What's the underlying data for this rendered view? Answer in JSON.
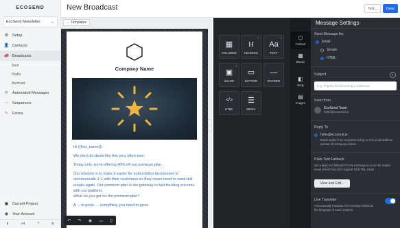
{
  "sidebar": {
    "logo": "ECOSEND",
    "account": "EcoSend Newsletter",
    "account_caret": "⌄",
    "items": [
      {
        "label": "Setup",
        "icon": "gear-icon",
        "glyph": "⚙"
      },
      {
        "label": "Contacts",
        "icon": "user-icon",
        "glyph": "👤"
      },
      {
        "label": "Broadcasts",
        "icon": "megaphone-icon",
        "glyph": "📣"
      }
    ],
    "broadcast_sub": [
      "Sent",
      "Drafts",
      "Archived"
    ],
    "items2": [
      {
        "label": "Automated Messages",
        "icon": "automation-icon",
        "glyph": "⟳"
      },
      {
        "label": "Sequences",
        "icon": "sequence-icon",
        "glyph": "⋯"
      },
      {
        "label": "Forms",
        "icon": "pencil-icon",
        "glyph": "✎"
      }
    ],
    "bottom": [
      {
        "label": "Current Project",
        "icon": "folder-icon",
        "glyph": "▣"
      },
      {
        "label": "Your Account",
        "icon": "account-icon",
        "glyph": "◉"
      }
    ],
    "bottom_bar": [
      "⬆",
      "v4",
      "?",
      "⚙"
    ]
  },
  "header": {
    "title": "New Broadcast",
    "test_label": "Test...",
    "done_label": "Done"
  },
  "canvas": {
    "templates_button": "← Templates",
    "company_name": "Company Name",
    "greeting": "Hi {{first_name}}!",
    "para1": "We don't do deals like this very often ever.",
    "para2": "Today only, we're offering 40% off our premium plan.",
    "para3": "Our mission is to make it easier for subscription businesses to communicate 1-1 with their customers so they never need to send dull emails again. Our premium plan is the gateway to fast tracking success with our platform.",
    "para4": "What do you get on the premium plan?",
    "para5": "A ... to grow.",
    "para6": "... everything you need to grow."
  },
  "blocks": [
    {
      "label": "COLUMNS",
      "icon": "columns-icon",
      "glyph": "▦"
    },
    {
      "label": "HEADING",
      "icon": "heading-icon",
      "glyph": "H"
    },
    {
      "label": "TEXT",
      "icon": "text-icon",
      "glyph": "Aa"
    },
    {
      "label": "IMAGE",
      "icon": "image-icon",
      "glyph": "▣"
    },
    {
      "label": "BUTTON",
      "icon": "button-icon",
      "glyph": "▭"
    },
    {
      "label": "DIVIDER",
      "icon": "divider-icon",
      "glyph": "—"
    },
    {
      "label": "HTML",
      "icon": "code-icon",
      "glyph": "</>"
    },
    {
      "label": "MENU",
      "icon": "menu-icon",
      "glyph": "☰"
    }
  ],
  "tabs": [
    {
      "label": "Content",
      "icon": "content-icon",
      "glyph": "⬡"
    },
    {
      "label": "Blocks",
      "icon": "blocks-icon",
      "glyph": "▦"
    },
    {
      "label": "Body",
      "icon": "body-icon",
      "glyph": "◧"
    },
    {
      "label": "Images",
      "icon": "images-icon",
      "glyph": "▤"
    }
  ],
  "settings": {
    "title": "Message Settings",
    "send_as_label": "Send Message As:",
    "send_as_options": [
      "Email",
      "Simple",
      "HTML"
    ],
    "subject_label": "Subject",
    "subject_placeholder": "E.g. Thanks for becoming a customer!",
    "send_from_label": "Send from",
    "sender_name": "EcoSend Team",
    "sender_email": "hello@ecosend.io",
    "reply_to_label": "Reply To",
    "reply_to_email": "hello@ecosend.io",
    "reply_note": "Email replies from recipients will go to this email address instead of GoSquared Inbox.",
    "plain_label": "Plain-Text Fallback",
    "plain_note": "Set a plain text fallback for this message so it can be read in email clients that don't support full HTML email.",
    "view_edit": "View and Edit...",
    "translate_label": "Live Translate",
    "translate_note": "Automatically translate this message based on the language of each recipient."
  }
}
